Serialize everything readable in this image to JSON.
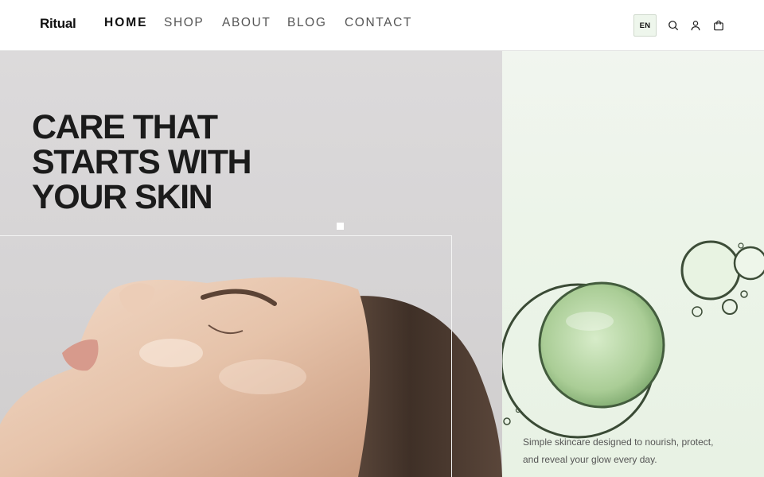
{
  "header": {
    "brand": "Ritual",
    "nav": [
      {
        "label": "HOME",
        "active": true
      },
      {
        "label": "SHOP",
        "active": false
      },
      {
        "label": "ABOUT",
        "active": false
      },
      {
        "label": "BLOG",
        "active": false
      },
      {
        "label": "CONTACT",
        "active": false
      }
    ],
    "language": "EN",
    "icons": [
      "search-icon",
      "user-icon",
      "cart-icon"
    ]
  },
  "hero": {
    "headline_lines": [
      "CARE THAT",
      "STARTS WITH",
      "YOUR SKIN"
    ],
    "image": "woman-face-profile-photo"
  },
  "side": {
    "image": "green-serum-bubbles-photo",
    "tagline": "Simple skincare designed to nourish, protect, and reveal your glow every day."
  },
  "colors": {
    "accent_green": "#eef6ec",
    "text_dark": "#1b1b1b",
    "hero_bg": "#d8d6d7",
    "side_bg": "#ecf4e9"
  }
}
